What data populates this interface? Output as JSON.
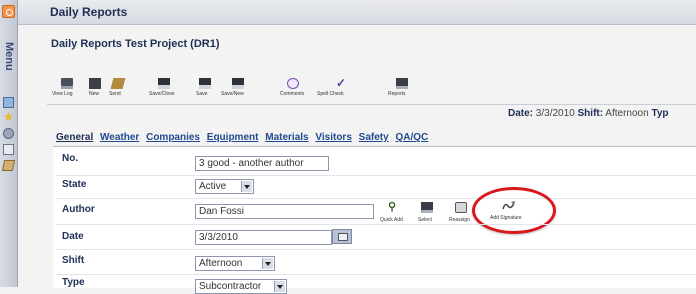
{
  "app": {
    "window_title": "Daily Reports",
    "project_title": "Daily Reports Test Project (DR1)",
    "side_menu_label": "Menu"
  },
  "toolbar": [
    {
      "label": "View Log",
      "icon": "view-log-icon"
    },
    {
      "label": "New",
      "icon": "new-icon"
    },
    {
      "label": "Send",
      "icon": "send-icon"
    },
    {
      "label": "Save/Close",
      "icon": "save-close-icon"
    },
    {
      "label": "Save",
      "icon": "save-icon"
    },
    {
      "label": "Save/New",
      "icon": "save-new-icon"
    },
    {
      "label": "Comments",
      "icon": "comments-icon"
    },
    {
      "label": "Spell Check",
      "icon": "spell-check-icon"
    },
    {
      "label": "Reports",
      "icon": "reports-icon"
    }
  ],
  "info_bar": {
    "date_label": "Date:",
    "date_value": "3/3/2010",
    "shift_label": "Shift:",
    "shift_value": "Afternoon",
    "type_label": "Typ"
  },
  "tabs": [
    "General",
    "Weather",
    "Companies",
    "Equipment",
    "Materials",
    "Visitors",
    "Safety",
    "QA/QC"
  ],
  "active_tab": "General",
  "form": {
    "no": {
      "label": "No.",
      "value": "3 good - another author"
    },
    "state": {
      "label": "State",
      "value": "Active"
    },
    "author": {
      "label": "Author",
      "value": "Dan Fossi"
    },
    "date": {
      "label": "Date",
      "value": "3/3/2010"
    },
    "shift": {
      "label": "Shift",
      "value": "Afternoon"
    },
    "type": {
      "label": "Type",
      "value": "Subcontractor"
    }
  },
  "author_actions": [
    {
      "label": "Quick Add",
      "icon": "quick-add-icon"
    },
    {
      "label": "Select",
      "icon": "select-icon"
    },
    {
      "label": "Reassign",
      "icon": "reassign-icon"
    },
    {
      "label": "Add Signature",
      "icon": "add-signature-icon"
    }
  ],
  "colors": {
    "highlight_ring": "#d9161c",
    "header_text": "#1e2f55",
    "tab_link": "#1f4a8e"
  }
}
